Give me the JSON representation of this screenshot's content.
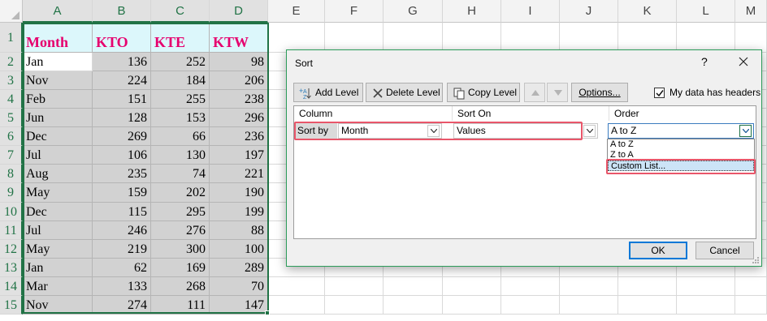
{
  "sheet": {
    "columns": [
      "A",
      "B",
      "C",
      "D",
      "E",
      "F",
      "G",
      "H",
      "I",
      "J",
      "K",
      "L",
      "M"
    ],
    "row_numbers": [
      "1",
      "2",
      "3",
      "4",
      "5",
      "6",
      "7",
      "8",
      "9",
      "10",
      "11",
      "12",
      "13",
      "14",
      "15"
    ],
    "header": [
      "Month",
      "KTO",
      "KTE",
      "KTW"
    ],
    "rows": [
      [
        "Jan",
        "136",
        "252",
        "98"
      ],
      [
        "Nov",
        "224",
        "184",
        "206"
      ],
      [
        "Feb",
        "151",
        "255",
        "238"
      ],
      [
        "Jun",
        "128",
        "153",
        "296"
      ],
      [
        "Dec",
        "269",
        "66",
        "236"
      ],
      [
        "Jul",
        "106",
        "130",
        "197"
      ],
      [
        "Aug",
        "235",
        "74",
        "221"
      ],
      [
        "May",
        "159",
        "202",
        "190"
      ],
      [
        "Dec",
        "115",
        "295",
        "199"
      ],
      [
        "Jul",
        "246",
        "276",
        "88"
      ],
      [
        "May",
        "219",
        "300",
        "100"
      ],
      [
        "Jan",
        "62",
        "169",
        "289"
      ],
      [
        "Mar",
        "133",
        "268",
        "70"
      ],
      [
        "Nov",
        "274",
        "111",
        "147"
      ]
    ]
  },
  "dialog": {
    "title": "Sort",
    "help": "?",
    "toolbar": {
      "add_level": "Add Level",
      "delete_level": "Delete Level",
      "copy_level": "Copy Level",
      "options": "Options...",
      "my_data_has_headers": "My data has headers"
    },
    "grid_headers": {
      "column": "Column",
      "sort_on": "Sort On",
      "order": "Order"
    },
    "level": {
      "label": "Sort by",
      "column_value": "Month",
      "sort_on_value": "Values",
      "order_value": "A to Z"
    },
    "order_options": [
      "A to Z",
      "Z to A",
      "Custom List..."
    ],
    "highlighted_option": "Custom List...",
    "ok": "OK",
    "cancel": "Cancel"
  },
  "colors": {
    "header_text": "#e6006e",
    "header_fill": "#dcf7fb",
    "data_fill": "#d2d2d2",
    "selection": "#217346",
    "callout": "#e9566a"
  }
}
